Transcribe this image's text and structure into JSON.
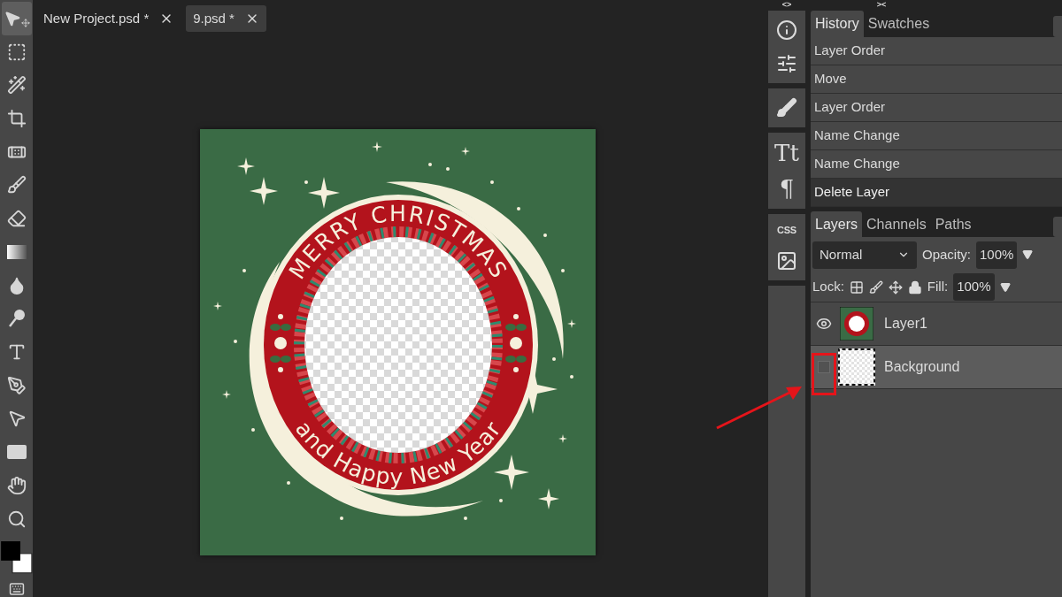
{
  "tools": [
    {
      "kind": "move",
      "selected": true
    },
    {
      "kind": "marquee",
      "selected": false
    },
    {
      "kind": "wand",
      "selected": false
    },
    {
      "kind": "crop",
      "selected": false
    },
    {
      "kind": "heal",
      "selected": false
    },
    {
      "kind": "brush",
      "selected": false
    },
    {
      "kind": "eraser",
      "selected": false
    },
    {
      "kind": "gradient",
      "selected": false
    },
    {
      "kind": "blur",
      "selected": false
    },
    {
      "kind": "dodge",
      "selected": false
    },
    {
      "kind": "type",
      "selected": false
    },
    {
      "kind": "pen",
      "selected": false
    },
    {
      "kind": "path-select",
      "selected": false
    },
    {
      "kind": "shape",
      "selected": false
    },
    {
      "kind": "hand",
      "selected": false
    },
    {
      "kind": "zoom",
      "selected": false
    }
  ],
  "document_tabs": [
    {
      "label": "New Project.psd *",
      "selected": false
    },
    {
      "label": "9.psd *",
      "selected": true
    }
  ],
  "artwork": {
    "top_text": "MERRY CHRISTMAS",
    "bottom_text": "and Happy New Year"
  },
  "strip_toggles": [
    "<>",
    "><"
  ],
  "panel_icons": [
    [
      {
        "kind": "info"
      },
      {
        "kind": "sliders"
      }
    ],
    [
      {
        "kind": "brush-settings"
      }
    ],
    [
      {
        "kind": "glyph",
        "text": "Tt"
      },
      {
        "kind": "glyph",
        "text": "¶"
      }
    ],
    [
      {
        "kind": "glyph",
        "text": "CSS"
      },
      {
        "kind": "image"
      }
    ]
  ],
  "history": {
    "tabs": [
      {
        "label": "History",
        "selected": true
      },
      {
        "label": "Swatches",
        "selected": false
      }
    ],
    "items": [
      {
        "label": "Layer Order",
        "selected": false
      },
      {
        "label": "Move",
        "selected": false
      },
      {
        "label": "Layer Order",
        "selected": false
      },
      {
        "label": "Name Change",
        "selected": false
      },
      {
        "label": "Name Change",
        "selected": false
      },
      {
        "label": "Delete Layer",
        "selected": true
      }
    ]
  },
  "layers": {
    "tabs": [
      {
        "label": "Layers",
        "selected": true
      },
      {
        "label": "Channels",
        "selected": false
      },
      {
        "label": "Paths",
        "selected": false
      }
    ],
    "blend_mode": "Normal",
    "opacity_label": "Opacity:",
    "opacity": "100%",
    "lock_label": "Lock:",
    "fill_label": "Fill:",
    "fill": "100%",
    "items": [
      {
        "name": "Layer1",
        "kind": "artwork",
        "visible": true,
        "selected": false
      },
      {
        "name": "Background",
        "kind": "transparent",
        "visible": false,
        "selected": true
      }
    ]
  }
}
